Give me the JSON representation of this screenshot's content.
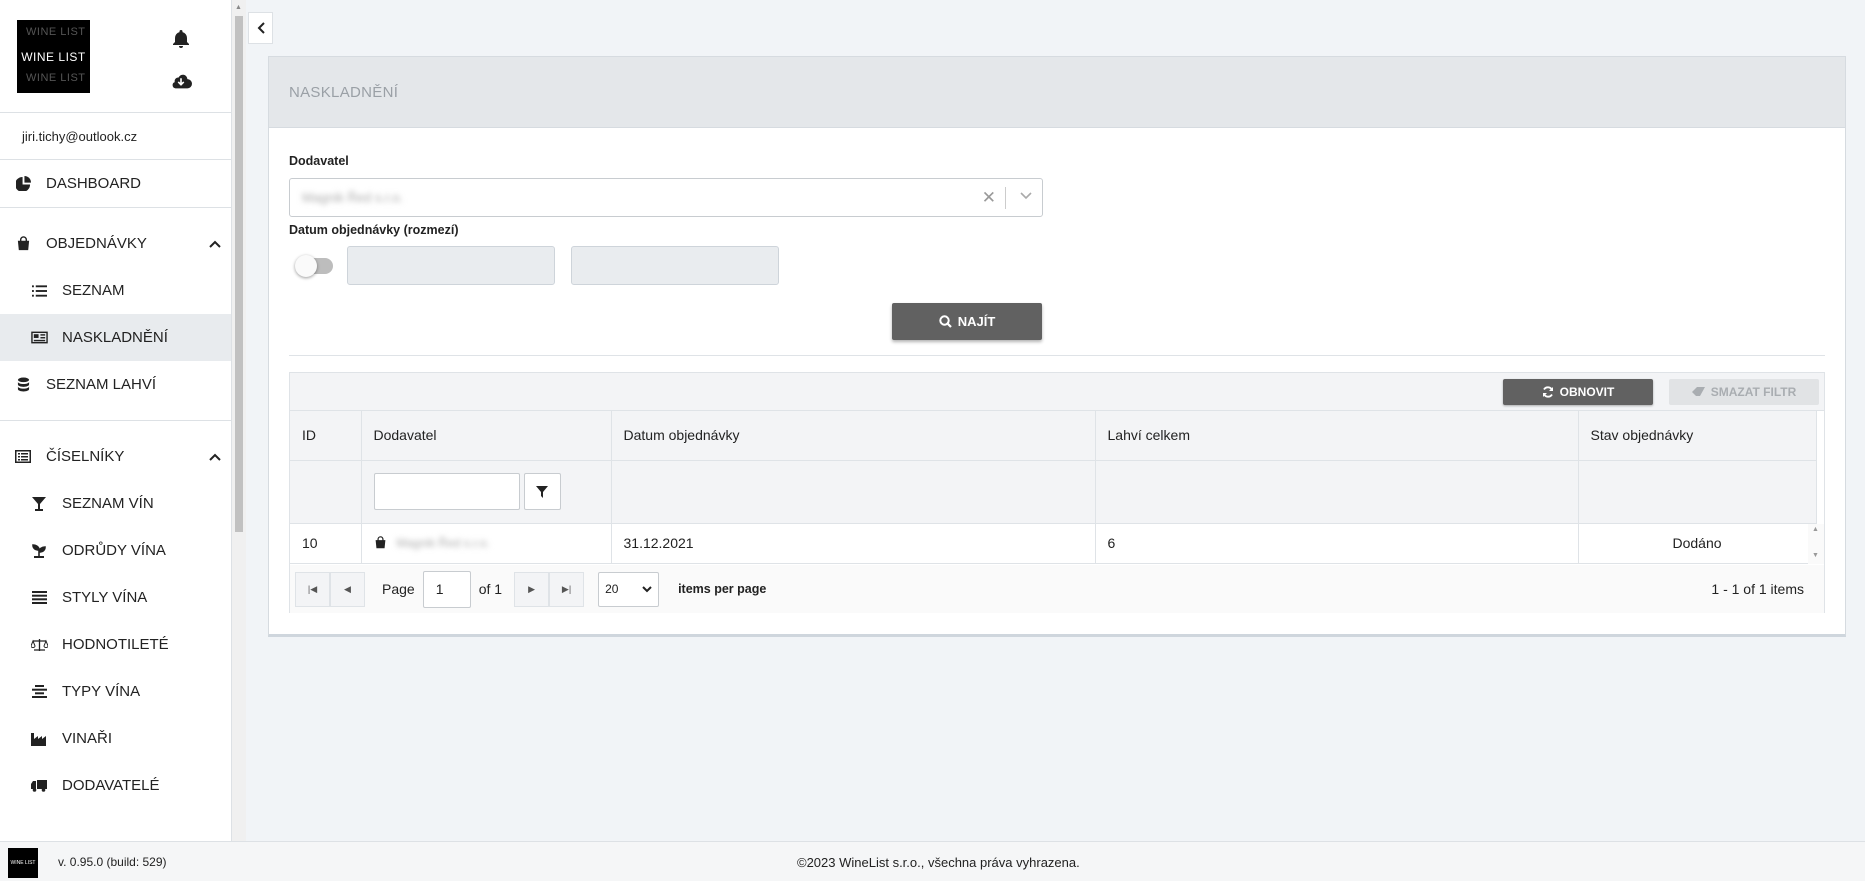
{
  "sidebar": {
    "logo_text": "WINE LIST",
    "email": "jiri.tichy@outlook.cz",
    "items": [
      {
        "label": "DASHBOARD"
      },
      {
        "label": "OBJEDNÁVKY"
      },
      {
        "label": "SEZNAM"
      },
      {
        "label": "NASKLADNĚNÍ"
      },
      {
        "label": "SEZNAM LAHVÍ"
      },
      {
        "label": "ČÍSELNÍKY"
      },
      {
        "label": "SEZNAM VÍN"
      },
      {
        "label": "ODRŮDY VÍNA"
      },
      {
        "label": "STYLY VÍNA"
      },
      {
        "label": "HODNOTILETÉ"
      },
      {
        "label": "TYPY VÍNA"
      },
      {
        "label": "VINAŘI"
      },
      {
        "label": "DODAVATELÉ"
      }
    ]
  },
  "page": {
    "title": "NASKLADNĚNÍ"
  },
  "form": {
    "supplier_label": "Dodavatel",
    "supplier_value": "Magnik Řed s.r.o.",
    "date_label": "Datum objednávky (rozmezí)",
    "find_button": "NAJÍT"
  },
  "grid": {
    "refresh_button": "OBNOVIT",
    "clear_filter_button": "SMAZAT FILTR",
    "columns": [
      "ID",
      "Dodavatel",
      "Datum objednávky",
      "Lahví celkem",
      "Stav objednávky"
    ],
    "rows": [
      {
        "id": "10",
        "supplier": "Magnik Řed s.r.o.",
        "date": "31.12.2021",
        "bottles": "6",
        "status": "Dodáno"
      }
    ]
  },
  "pager": {
    "page_label": "Page",
    "page_value": "1",
    "of_label": "of 1",
    "per_page_value": "20",
    "per_page_label": "items per page",
    "range": "1 - 1 of 1 items"
  },
  "footer": {
    "mini_logo": "WINE LIST",
    "version": "v. 0.95.0 (build: 529)",
    "copyright": "©2023 WineList s.r.o., všechna práva vyhrazena."
  },
  "icons": {
    "bell": "bell-icon",
    "cloud_download": "cloud-download-icon",
    "dashboard": "pie-chart-icon",
    "orders": "shopping-bag-icon",
    "list": "list-icon",
    "stock_in": "newspaper-icon",
    "bottles": "database-icon",
    "codebooks": "list-alt-icon",
    "wines": "cocktail-icon",
    "grapes": "seedling-icon",
    "styles": "bars-icon",
    "ratings": "balance-scale-icon",
    "types": "align-center-icon",
    "winemakers": "industry-icon",
    "suppliers": "truck-icon"
  }
}
